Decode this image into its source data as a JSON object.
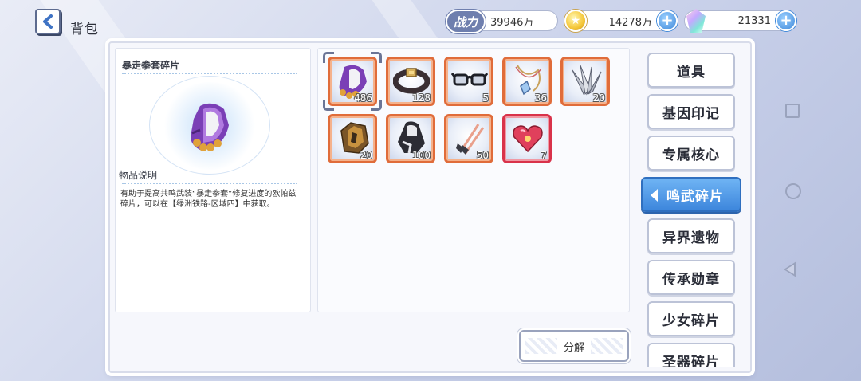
{
  "header": {
    "title": "背包",
    "power_label": "战力",
    "power_value": "39946万",
    "gold_value": "14278万",
    "crystal_value": "21331"
  },
  "detail": {
    "item_name": "暴走拳套碎片",
    "desc_title": "物品说明",
    "desc_text": "有助于提高共鸣武装“暴走拳套”修复进度的欧帕兹碎片，可以在【绿洲铁路-区域四】中获取。"
  },
  "items": [
    {
      "icon": "purple-glove-icon",
      "count": "486",
      "frame": "orange"
    },
    {
      "icon": "leather-belt-icon",
      "count": "128",
      "frame": "orange"
    },
    {
      "icon": "glasses-icon",
      "count": "5",
      "frame": "orange"
    },
    {
      "icon": "pendant-necklace-icon",
      "count": "36",
      "frame": "orange"
    },
    {
      "icon": "blade-wings-icon",
      "count": "20",
      "frame": "orange"
    },
    {
      "icon": "golden-helmet-icon",
      "count": "20",
      "frame": "orange"
    },
    {
      "icon": "dark-cloak-icon",
      "count": "100",
      "frame": "orange"
    },
    {
      "icon": "twin-daggers-icon",
      "count": "50",
      "frame": "orange"
    },
    {
      "icon": "crystal-heart-icon",
      "count": "7",
      "frame": "red"
    }
  ],
  "decompose_label": "分解",
  "tabs": [
    {
      "label": "道具",
      "active": false
    },
    {
      "label": "基因印记",
      "active": false
    },
    {
      "label": "专属核心",
      "active": false
    },
    {
      "label": "鸣武碎片",
      "active": true
    },
    {
      "label": "异界遗物",
      "active": false
    },
    {
      "label": "传承勋章",
      "active": false
    },
    {
      "label": "少女碎片",
      "active": false
    },
    {
      "label": "圣器碎片",
      "active": false
    }
  ],
  "colors": {
    "accent_blue": "#3d86dc",
    "frame_orange": "#e06c3a",
    "frame_red": "#d9324a"
  }
}
